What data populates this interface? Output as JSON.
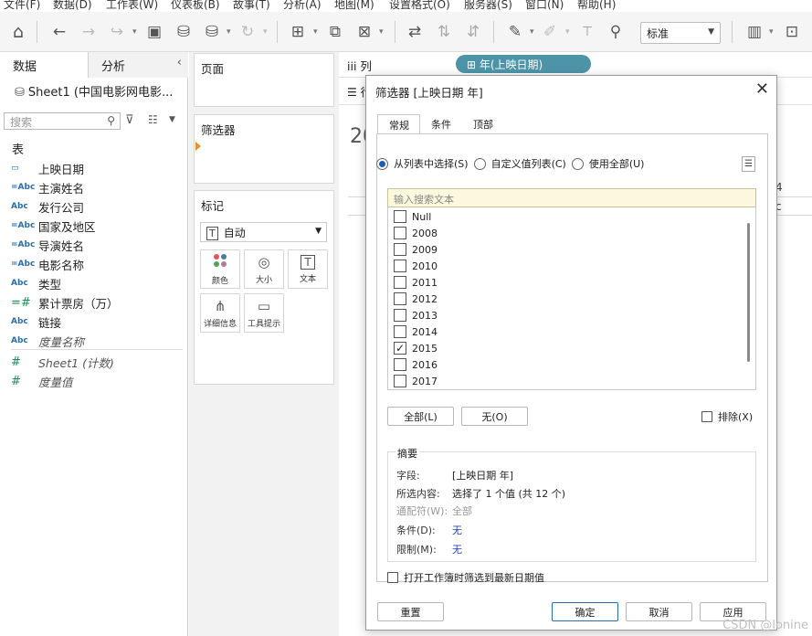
{
  "menubar": {
    "items": [
      "文件(F)",
      "数据(D)",
      "工作表(W)",
      "仪表板(B)",
      "故事(T)",
      "分析(A)",
      "地图(M)",
      "设置格式(O)",
      "服务器(S)",
      "窗口(N)",
      "帮助(H)"
    ]
  },
  "toolbar": {
    "icons": [
      "home-icon",
      "undo-icon",
      "redo-icon",
      "replay-icon",
      "save-icon",
      "new-datasource-icon",
      "pause-updates-icon",
      "refresh-icon",
      "new-worksheet-icon",
      "duplicate-icon",
      "clear-sheet-icon",
      "swap-icon",
      "sort-asc-icon",
      "sort-desc-icon",
      "highlight-icon",
      "annotate-icon",
      "labels-icon",
      "pin-icon",
      "show-me-icon",
      "presentation-icon"
    ],
    "fit_value": "标准"
  },
  "data_pane": {
    "tabs": [
      "数据",
      "分析"
    ],
    "collapse_icon": "chevron-left-icon",
    "datasource": "Sheet1 (中国电影网电影...",
    "search_placeholder": "搜索",
    "table_heading": "表",
    "fields": [
      {
        "type": "日",
        "name": "上映日期",
        "kind": "date"
      },
      {
        "type": "=Abc",
        "name": "主演姓名",
        "kind": "calc"
      },
      {
        "type": "Abc",
        "name": "发行公司",
        "kind": "string"
      },
      {
        "type": "=Abc",
        "name": "国家及地区",
        "kind": "calc"
      },
      {
        "type": "=Abc",
        "name": "导演姓名",
        "kind": "calc"
      },
      {
        "type": "=Abc",
        "name": "电影名称",
        "kind": "calc"
      },
      {
        "type": "Abc",
        "name": "类型",
        "kind": "string"
      },
      {
        "type": "=#",
        "name": "累计票房（万）",
        "kind": "measure"
      },
      {
        "type": "Abc",
        "name": "链接",
        "kind": "string"
      },
      {
        "type": "Abc",
        "name": "度量名称",
        "kind": "italic"
      }
    ],
    "measures": [
      {
        "type": "#",
        "name": "Sheet1 (计数)"
      },
      {
        "type": "#",
        "name": "度量值"
      }
    ]
  },
  "shelves": {
    "pages_title": "页面",
    "filters_title": "筛选器",
    "marks_title": "标记",
    "marks_type": "自动",
    "mark_buttons": [
      {
        "icon": "color-icon",
        "label": "颜色"
      },
      {
        "icon": "size-icon",
        "label": "大小"
      },
      {
        "icon": "text-icon",
        "label": "文本"
      },
      {
        "icon": "detail-icon",
        "label": "详细信息"
      },
      {
        "icon": "tooltip-icon",
        "label": "工具提示"
      }
    ]
  },
  "canvas": {
    "columns_label": "列",
    "rows_label": "行",
    "column_pill": "年(上映日期)",
    "title_peek": "20",
    "header_peek": "4",
    "cell_peek": "c"
  },
  "dialog": {
    "title": "筛选器 [上映日期 年]",
    "tabs": [
      "常规",
      "条件",
      "顶部"
    ],
    "radio_options": [
      {
        "label": "从列表中选择(S)",
        "selected": true
      },
      {
        "label": "自定义值列表(C)",
        "selected": false
      },
      {
        "label": "使用全部(U)",
        "selected": false
      }
    ],
    "search_placeholder": "输入搜索文本",
    "values": [
      {
        "label": "Null",
        "checked": false
      },
      {
        "label": "2008",
        "checked": false
      },
      {
        "label": "2009",
        "checked": false
      },
      {
        "label": "2010",
        "checked": false
      },
      {
        "label": "2011",
        "checked": false
      },
      {
        "label": "2012",
        "checked": false
      },
      {
        "label": "2013",
        "checked": false
      },
      {
        "label": "2014",
        "checked": false
      },
      {
        "label": "2015",
        "checked": true
      },
      {
        "label": "2016",
        "checked": false
      },
      {
        "label": "2017",
        "checked": false
      }
    ],
    "all_button": "全部(L)",
    "none_button": "无(O)",
    "exclude_label": "排除(X)",
    "summary": {
      "title": "摘要",
      "rows": [
        {
          "key": "字段:",
          "value": "[上映日期 年]",
          "style": ""
        },
        {
          "key": "所选内容:",
          "value": "选择了 1 个值 (共 12 个)",
          "style": ""
        },
        {
          "key": "通配符(W):",
          "value": "全部",
          "style": "dim"
        },
        {
          "key": "条件(D):",
          "value": "无",
          "style": "link"
        },
        {
          "key": "限制(M):",
          "value": "无",
          "style": "link"
        }
      ]
    },
    "latest_date_label": "打开工作簿时筛选到最新日期值",
    "reset_button": "重置",
    "ok_button": "确定",
    "cancel_button": "取消",
    "apply_button": "应用"
  },
  "watermark": "CSDN @lonine"
}
